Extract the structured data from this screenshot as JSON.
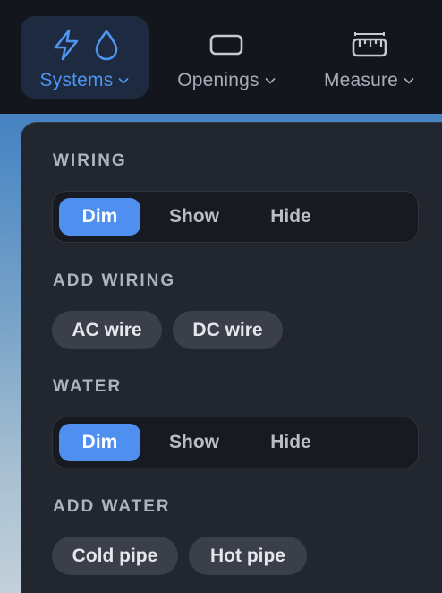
{
  "toolbar": {
    "systems": {
      "label": "Systems",
      "icons": [
        "bolt-icon",
        "water-drop-icon"
      ],
      "active": true
    },
    "openings": {
      "label": "Openings",
      "icons": [
        "rectangle-icon"
      ],
      "active": false
    },
    "measure": {
      "label": "Measure",
      "icons": [
        "ruler-icon"
      ],
      "active": false
    }
  },
  "panel": {
    "wiring": {
      "title": "WIRING",
      "options": [
        "Dim",
        "Show",
        "Hide"
      ],
      "selected": "Dim"
    },
    "add_wiring": {
      "title": "ADD WIRING",
      "chips": [
        "AC wire",
        "DC wire"
      ]
    },
    "water": {
      "title": "WATER",
      "options": [
        "Dim",
        "Show",
        "Hide"
      ],
      "selected": "Dim"
    },
    "add_water": {
      "title": "ADD WATER",
      "chips": [
        "Cold pipe",
        "Hot pipe"
      ]
    }
  },
  "colors": {
    "accent": "#4f8ff0",
    "toolbar_bg": "#13161d",
    "panel_bg": "#22262e",
    "chip_bg": "#3a3f4a"
  }
}
